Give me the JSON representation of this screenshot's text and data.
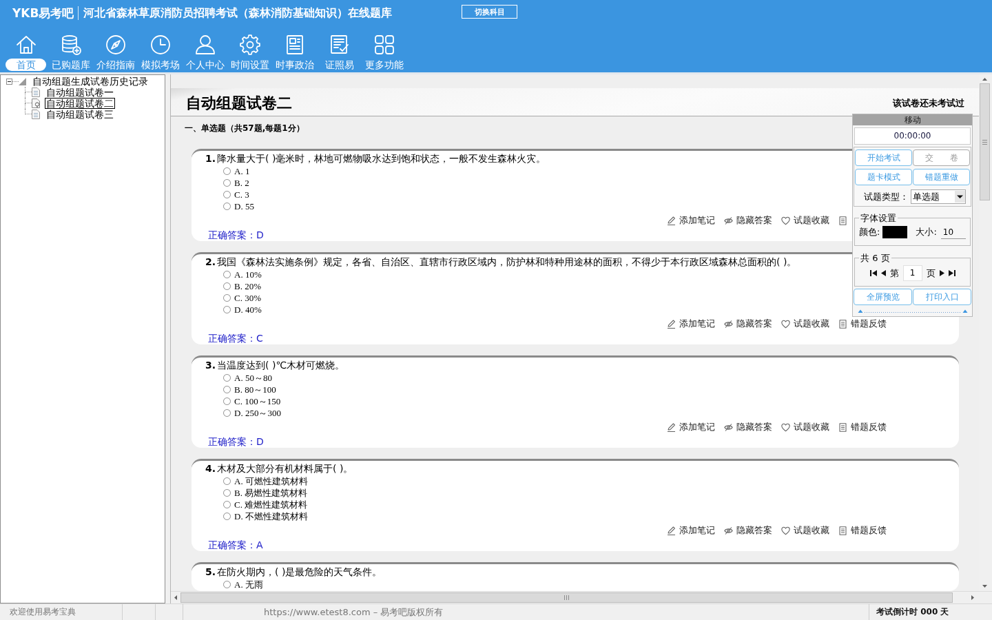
{
  "header": {
    "logo": "YKB易考吧",
    "title": "河北省森林草原消防员招聘考试（森林消防基础知识）在线题库",
    "switch_button": "切换科目"
  },
  "nav": [
    {
      "kind": "home",
      "label": "首页",
      "selected": true
    },
    {
      "kind": "database",
      "label": "已购题库",
      "selected": false
    },
    {
      "kind": "compass",
      "label": "介绍指南",
      "selected": false
    },
    {
      "kind": "clock",
      "label": "模拟考场",
      "selected": false
    },
    {
      "kind": "user",
      "label": "个人中心",
      "selected": false
    },
    {
      "kind": "gear",
      "label": "时间设置",
      "selected": false
    },
    {
      "kind": "newspaper",
      "label": "时事政治",
      "selected": false
    },
    {
      "kind": "checklist",
      "label": "证照易",
      "selected": false
    },
    {
      "kind": "grid",
      "label": "更多功能",
      "selected": false
    }
  ],
  "tree": {
    "label": "自动组题生成试卷历史记录",
    "expanded": true,
    "children": [
      {
        "label": "自动组题试卷一",
        "selected": false
      },
      {
        "label": "自动组题试卷二",
        "selected": true
      },
      {
        "label": "自动组题试卷三",
        "selected": false
      }
    ]
  },
  "paper": {
    "title": "自动组题试卷二",
    "status": "该试卷还未考试过",
    "section": "一、单选题（共57题,每题1分）",
    "questions": [
      {
        "number": "1.",
        "text": "降水量大于( )毫米时，林地可燃物吸水达到饱和状态，一般不发生森林火灾。",
        "options": [
          {
            "label": "A. 1",
            "selected": false
          },
          {
            "label": "B. 2",
            "selected": false
          },
          {
            "label": "C. 3",
            "selected": false
          },
          {
            "label": "D. 55",
            "selected": false
          }
        ],
        "actions": [
          {
            "kind": "note",
            "label": "添加笔记"
          },
          {
            "kind": "hide",
            "label": "隐藏答案"
          },
          {
            "kind": "favorite",
            "label": "试题收藏"
          },
          {
            "kind": "feedback"
          }
        ],
        "answer": "正确答案：D"
      },
      {
        "number": "2.",
        "text": "我国《森林法实施条例》规定，各省、自治区、直辖市行政区域内，防护林和特种用途林的面积，不得少于本行政区域森林总面积的( )。",
        "options": [
          {
            "label": "A. 10%",
            "selected": false
          },
          {
            "label": "B. 20%",
            "selected": false
          },
          {
            "label": "C. 30%",
            "selected": false
          },
          {
            "label": "D. 40%",
            "selected": false
          }
        ],
        "actions": [
          {
            "kind": "note",
            "label": "添加笔记"
          },
          {
            "kind": "hide",
            "label": "隐藏答案"
          },
          {
            "kind": "favorite",
            "label": "试题收藏"
          },
          {
            "kind": "feedback",
            "label": "错题反馈"
          }
        ],
        "answer": "正确答案：C"
      },
      {
        "number": "3.",
        "text": "当温度达到( )℃木材可燃烧。",
        "options": [
          {
            "label": "A. 50～80",
            "selected": false
          },
          {
            "label": "B. 80～100",
            "selected": false
          },
          {
            "label": "C. 100～150",
            "selected": false
          },
          {
            "label": "D. 250～300",
            "selected": false
          }
        ],
        "actions": [
          {
            "kind": "note",
            "label": "添加笔记"
          },
          {
            "kind": "hide",
            "label": "隐藏答案"
          },
          {
            "kind": "favorite",
            "label": "试题收藏"
          },
          {
            "kind": "feedback",
            "label": "错题反馈"
          }
        ],
        "answer": "正确答案：D"
      },
      {
        "number": "4.",
        "text": "木材及大部分有机材料属于( )。",
        "options": [
          {
            "label": "A. 可燃性建筑材料",
            "selected": false
          },
          {
            "label": "B. 易燃性建筑材料",
            "selected": false
          },
          {
            "label": "C. 难燃性建筑材料",
            "selected": false
          },
          {
            "label": "D. 不燃性建筑材料",
            "selected": false
          }
        ],
        "actions": [
          {
            "kind": "note",
            "label": "添加笔记"
          },
          {
            "kind": "hide",
            "label": "隐藏答案"
          },
          {
            "kind": "favorite",
            "label": "试题收藏"
          },
          {
            "kind": "feedback",
            "label": "错题反馈"
          }
        ],
        "answer": "正确答案：A"
      },
      {
        "number": "5.",
        "text": "在防火期内，( )是最危险的天气条件。",
        "options": [
          {
            "label": "A. 无雨",
            "selected": false
          }
        ]
      }
    ]
  },
  "panel": {
    "header": "移动",
    "timer": "00:00:00",
    "buttons": [
      {
        "label": "开始考试",
        "disabled": false
      },
      {
        "label": "交　　卷",
        "disabled": true
      },
      {
        "label": "题卡模式",
        "disabled": false
      },
      {
        "label": "错题重做",
        "disabled": false
      }
    ],
    "type_label": "试题类型：",
    "type_value": "单选题",
    "font": {
      "legend": "字体设置",
      "color_label": "颜色:",
      "color": "#000000",
      "size_label": "大小:",
      "size": "10"
    },
    "pager": {
      "legend": "共 6 页",
      "prefix": "第",
      "page": "1",
      "suffix": "页"
    },
    "bottom_buttons": [
      {
        "label": "全屏预览",
        "disabled": false
      },
      {
        "label": "打印入口",
        "disabled": false
      }
    ]
  },
  "status_bar": {
    "message": "欢迎使用易考宝典",
    "copyright": "https://www.etest8.com – 易考吧版权所有",
    "countdown": "考试倒计时 000 天"
  }
}
